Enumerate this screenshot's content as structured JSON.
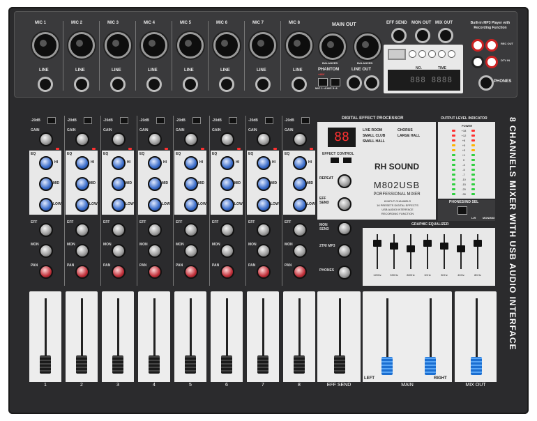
{
  "top": {
    "mic_labels": [
      "MIC 1",
      "MIC 2",
      "MIC 3",
      "MIC 4",
      "MIC 5",
      "MIC 6",
      "MIC 7",
      "MIC 8"
    ],
    "line_label": "LINE",
    "main_out": "MAIN OUT",
    "balanced": "BALANCED",
    "phantom": "PHANTOM",
    "phantom_sub": "+48V",
    "mic_sel": "MIC 1~4   MIC 5~8",
    "line_out": "LINE OUT",
    "eff_send": "EFF SEND",
    "mon_out": "MON OUT",
    "mix_out": "MIX OUT",
    "mp3_title": "Built-in MP3 Player with Recording Function",
    "mp3_no": "NO.",
    "mp3_time": "TIME",
    "rec_out": "REC OUT",
    "dtv_in": "DTV IN",
    "phones": "PHONES"
  },
  "channel_strip": {
    "pad": "-20dB",
    "gain": "GAIN",
    "eq": "EQ",
    "hi": "HI",
    "mid": "MID",
    "low": "LOW",
    "eff": "EFF",
    "mon": "MON",
    "pan": "PAN",
    "numbers": [
      "1",
      "2",
      "3",
      "4",
      "5",
      "6",
      "7",
      "8"
    ]
  },
  "dsp": {
    "title": "DIGITAL EFFECT PROCESSOR",
    "display": "88",
    "effect_control": "EFFECT CONTROL",
    "repeat": "REPEAT",
    "eff_send": "EFF SEND",
    "brand": "RH SOUND",
    "model": "M802USB",
    "subtitle": "PORFESSIONAL MIXER",
    "features": [
      "8 INPUT CHANNELS",
      "16 PRESETS DIGITAL EFFECTS",
      "USB AUDIO INTERFACE",
      "RECORDING FUNCTION"
    ],
    "presets": [
      "LIVE ROOM",
      "SMALL CLUB",
      "SMALL HALL",
      "CHORUS",
      "LARGE HALL"
    ],
    "mon_send": "MON SEND",
    "mp3_2tr": "2TR/ MP3",
    "phones": "PHONES"
  },
  "meter": {
    "title": "OUTPUT LEVEL INDICATOR",
    "power": "POWER",
    "phones_sel": "PHONES/IND SEL",
    "lr": "L/R",
    "monitor": "MON/MIX",
    "scale": [
      "+18",
      "+12",
      "+8",
      "+5",
      "+3",
      "+1",
      "0",
      "-3",
      "-5",
      "-7",
      "-10",
      "-15",
      "-20",
      "-30"
    ]
  },
  "geq": {
    "title": "GRAPHIC EQUALIZER",
    "bands": [
      "120Hz",
      "330Hz",
      "800Hz",
      "1KHz",
      "3KHz",
      "4KHz",
      "8KHz"
    ]
  },
  "faders": {
    "eff_send": "EFF SEND",
    "main": "MAIN",
    "left": "LEFT",
    "right": "RIGHT",
    "mix_out": "MIX OUT"
  },
  "side_title": "8 CHANNELS MIXER WITH USB AUDIO INTERFACE"
}
